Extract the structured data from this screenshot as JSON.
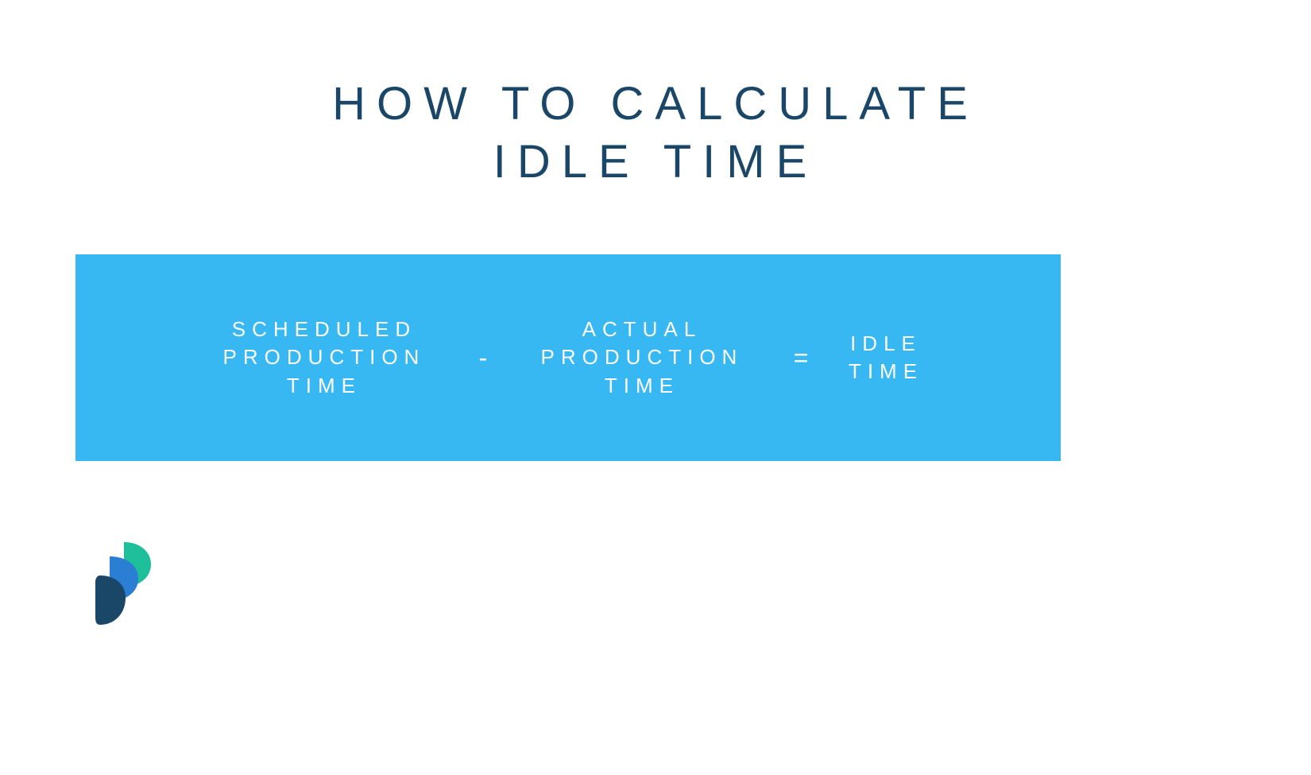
{
  "title": "HOW TO CALCULATE\nIDLE TIME",
  "formula": {
    "term1": "SCHEDULED\nPRODUCTION\nTIME",
    "op1": "-",
    "term2": "ACTUAL\nPRODUCTION\nTIME",
    "op2": "=",
    "term3": "IDLE\nTIME"
  },
  "colors": {
    "title": "#1a4767",
    "box": "#38b8f2",
    "text": "#ffffff"
  }
}
